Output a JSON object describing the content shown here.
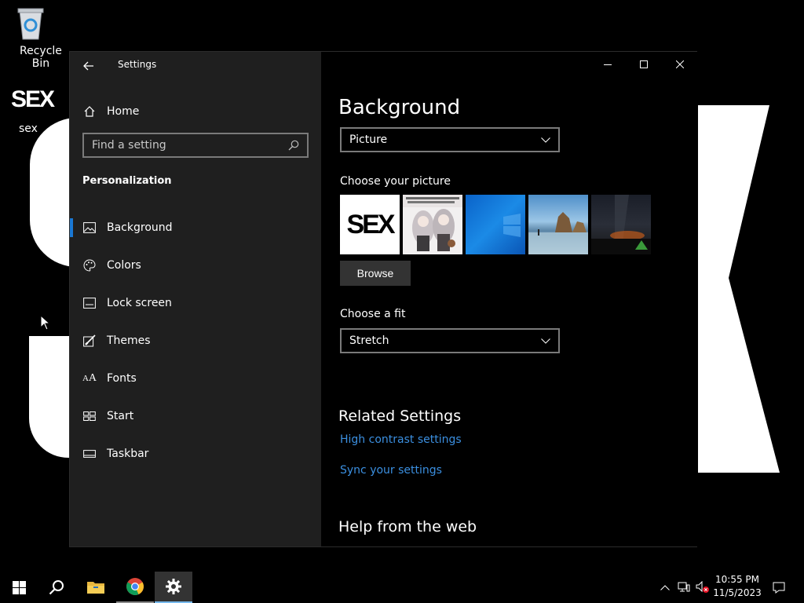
{
  "desktop": {
    "icons": [
      {
        "label": "Recycle Bin"
      },
      {
        "label": "sex",
        "image_text": "SEX"
      }
    ]
  },
  "window": {
    "title": "Settings",
    "sidebar": {
      "home_label": "Home",
      "search_placeholder": "Find a setting",
      "section_title": "Personalization",
      "items": [
        {
          "label": "Background",
          "icon": "picture-icon",
          "active": true
        },
        {
          "label": "Colors",
          "icon": "palette-icon"
        },
        {
          "label": "Lock screen",
          "icon": "lock-screen-icon"
        },
        {
          "label": "Themes",
          "icon": "brush-icon"
        },
        {
          "label": "Fonts",
          "icon": "fonts-icon"
        },
        {
          "label": "Start",
          "icon": "start-icon"
        },
        {
          "label": "Taskbar",
          "icon": "taskbar-icon"
        }
      ]
    },
    "content": {
      "heading": "Background",
      "background_type": "Picture",
      "choose_picture_label": "Choose your picture",
      "pictures": [
        {
          "name": "sex",
          "text": "SEX"
        },
        {
          "name": "anime"
        },
        {
          "name": "windows-default"
        },
        {
          "name": "beach"
        },
        {
          "name": "night-sky"
        }
      ],
      "browse_label": "Browse",
      "choose_fit_label": "Choose a fit",
      "fit_value": "Stretch",
      "related_heading": "Related Settings",
      "related_links": [
        "High contrast settings",
        "Sync your settings"
      ],
      "help_heading": "Help from the web"
    }
  },
  "taskbar": {
    "time": "10:55 PM",
    "date": "11/5/2023"
  },
  "colors": {
    "accent": "#1a78d4",
    "link": "#3b8fe0",
    "sidebar_bg": "#1f1f1f"
  }
}
